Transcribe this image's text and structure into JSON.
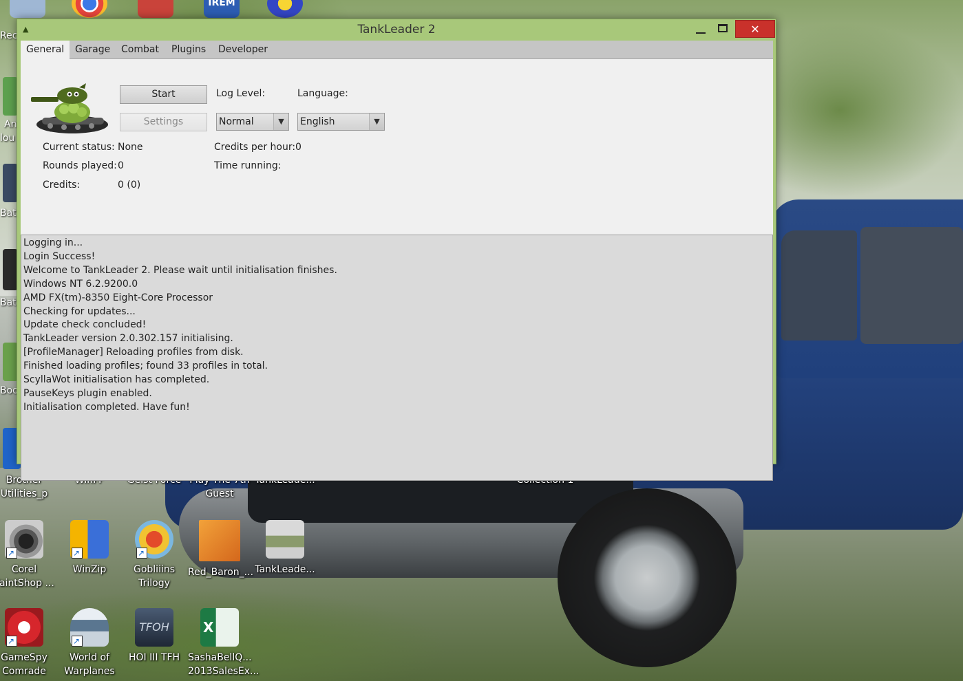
{
  "window": {
    "title": "TankLeader 2",
    "close_glyph": "✕"
  },
  "tabs": [
    {
      "label": "General",
      "active": true
    },
    {
      "label": "Garage",
      "active": false
    },
    {
      "label": "Combat",
      "active": false
    },
    {
      "label": "Plugins",
      "active": false
    },
    {
      "label": "Developer",
      "active": false
    }
  ],
  "general": {
    "start_label": "Start",
    "settings_label": "Settings",
    "log_level_label": "Log Level:",
    "log_level_value": "Normal",
    "language_label": "Language:",
    "language_value": "English",
    "current_status_label": "Current status:",
    "current_status_value": "None",
    "rounds_played_label": "Rounds played:",
    "rounds_played_value": "0",
    "credits_label": "Credits:",
    "credits_value": "0 (0)",
    "credits_per_hour_label": "Credits per hour:",
    "credits_per_hour_value": "0",
    "time_running_label": "Time running:"
  },
  "log": [
    "Logging in...",
    "Login Success!",
    "Welcome to TankLeader 2. Please wait until initialisation finishes.",
    "Windows NT 6.2.9200.0",
    "AMD FX(tm)-8350 Eight-Core Processor",
    "Checking for updates...",
    "Update check concluded!",
    "TankLeader version 2.0.302.157 initialising.",
    "[ProfileManager] Reloading profiles from disk.",
    "Finished loading profiles; found 33 profiles in total.",
    "ScyllaWot initialisation has completed.",
    "PauseKeys plugin enabled.",
    "Initialisation completed. Have fun!"
  ],
  "desktop": {
    "partial_labels": [
      "Recy",
      "An",
      "lou",
      "Batt",
      "Bat",
      "Bool"
    ],
    "top_icon_text": "IREM",
    "icons_row1": [
      {
        "line1": "Brother",
        "line2": "Utilities_p"
      },
      {
        "line1": "WinFF",
        "line2": ""
      },
      {
        "line1": "Geist Force",
        "line2": ""
      },
      {
        "line1": "Play The 7th",
        "line2": "Guest"
      },
      {
        "line1": "TankLeade...",
        "line2": ""
      },
      {
        "line1": "Collection 1",
        "line2": ""
      }
    ],
    "icons_row2": [
      {
        "line1": "Corel",
        "line2": "PaintShop ..."
      },
      {
        "line1": "WinZip",
        "line2": ""
      },
      {
        "line1": "Gobliiins",
        "line2": "Trilogy"
      },
      {
        "line1": "Red_Baron_...",
        "line2": ""
      },
      {
        "line1": "TankLeade...",
        "line2": ""
      }
    ],
    "icons_row3": [
      {
        "line1": "GameSpy",
        "line2": "Comrade"
      },
      {
        "line1": "World of",
        "line2": "Warplanes"
      },
      {
        "line1": "HOI III TFH",
        "line2": ""
      },
      {
        "line1": "SashaBellQ...",
        "line2": "2013SalesEx..."
      }
    ],
    "hoi_glyph_text": "TFOH",
    "excel_glyph_text": "X"
  }
}
